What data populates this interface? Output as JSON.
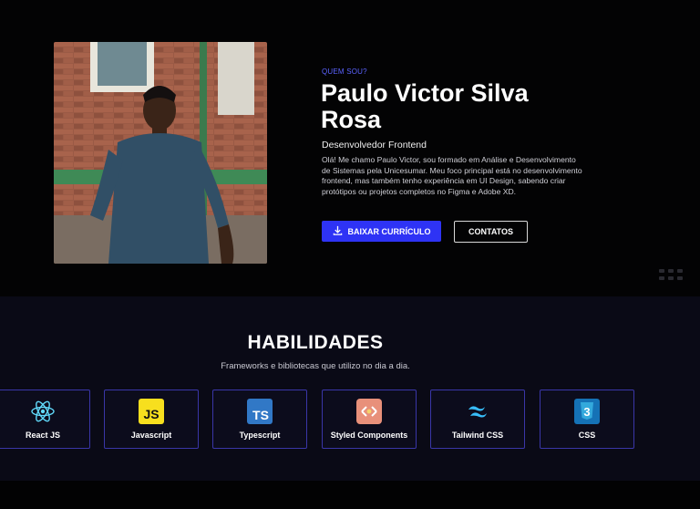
{
  "hero": {
    "eyebrow": "QUEM SOU?",
    "name": "Paulo Victor Silva Rosa",
    "role": "Desenvolvedor Frontend",
    "bio": "Olá! Me chamo Paulo Victor, sou formado em Análise e Desenvolvimento de Sistemas pela Unicesumar. Meu foco principal está no desenvolvimento frontend, mas também tenho experiência em UI Design, sabendo criar protótipos ou projetos completos no Figma e Adobe XD.",
    "download_label": "BAIXAR CURRÍCULO",
    "contact_label": "CONTATOS"
  },
  "skills": {
    "title": "HABILIDADES",
    "subtitle": "Frameworks e bibliotecas que utilizo no dia a dia.",
    "items": [
      {
        "label": "React JS",
        "icon": "react-icon"
      },
      {
        "label": "Javascript",
        "icon": "javascript-icon"
      },
      {
        "label": "Typescript",
        "icon": "typescript-icon"
      },
      {
        "label": "Styled Components",
        "icon": "styled-components-icon"
      },
      {
        "label": "Tailwind CSS",
        "icon": "tailwind-icon"
      },
      {
        "label": "CSS",
        "icon": "css-icon"
      }
    ]
  },
  "colors": {
    "accent": "#2e33f5",
    "eyebrow": "#5b63ff",
    "card_border": "#3a36a8"
  }
}
